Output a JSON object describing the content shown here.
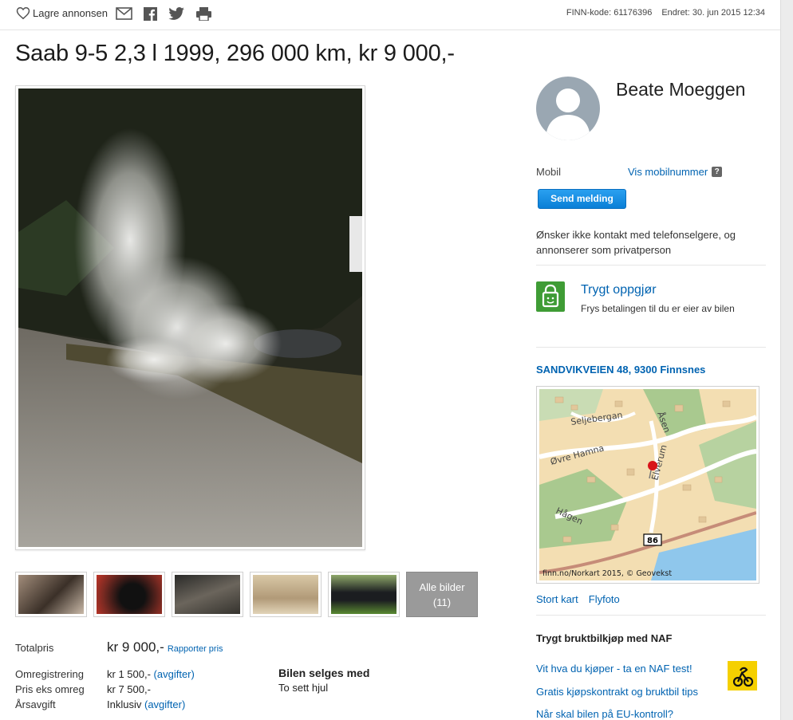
{
  "topbar": {
    "save_label": "Lagre annonsen",
    "finn_code": "FINN-kode: 61176396",
    "updated": "Endret: 30. jun 2015 12:34"
  },
  "title": "Saab 9-5 2,3 l 1999, 296 000 km, kr 9 000,-",
  "gallery": {
    "all_images_label": "Alle bilder",
    "all_images_count": "(11)"
  },
  "price": {
    "total_label": "Totalpris",
    "total_value": "kr 9 000,-",
    "report_label": "Rapporter pris",
    "rows": [
      {
        "label": "Omregistrering",
        "value": "kr 1 500,-",
        "link": "(avgifter)"
      },
      {
        "label": "Pris eks omreg",
        "value": "kr 7 500,-",
        "link": ""
      },
      {
        "label": "Årsavgift",
        "value": "Inklusiv",
        "link": "(avgifter)"
      }
    ],
    "sold_with_heading": "Bilen selges med",
    "sold_with_item": "To sett hjul"
  },
  "seller": {
    "name": "Beate Moeggen",
    "mobile_label": "Mobil",
    "mobile_link": "Vis mobilnummer",
    "help_mark": "?",
    "send_button": "Send melding",
    "notice": "Ønsker ikke kontakt med telefonselgere, og annonserer som privatperson"
  },
  "safe_payment": {
    "title": "Trygt oppgjør",
    "description": "Frys betalingen til du er eier av bilen"
  },
  "location": {
    "address": "SANDVIKVEIEN 48, 9300 Finnsnes",
    "map_labels": {
      "road1": "Seljebergan",
      "road2": "Åsen",
      "road3": "Øvre Hamna",
      "road4": "Elverum",
      "road5": "Hågen",
      "route": "86",
      "credit": "finn.no/Norkart 2015, © Geovekst"
    },
    "big_map": "Stort kart",
    "aerial": "Flyfoto"
  },
  "naf": {
    "heading": "Trygt bruktbilkjøp med NAF",
    "links": [
      "Vit hva du kjøper - ta en NAF test!",
      "Gratis kjøpskontrakt og bruktbil tips",
      "Når skal bilen på EU-kontroll?"
    ]
  },
  "colors": {
    "link": "#0063b1",
    "button": "#0a7fd6",
    "safe_green": "#3f9c35",
    "naf_yellow": "#f5d000"
  }
}
